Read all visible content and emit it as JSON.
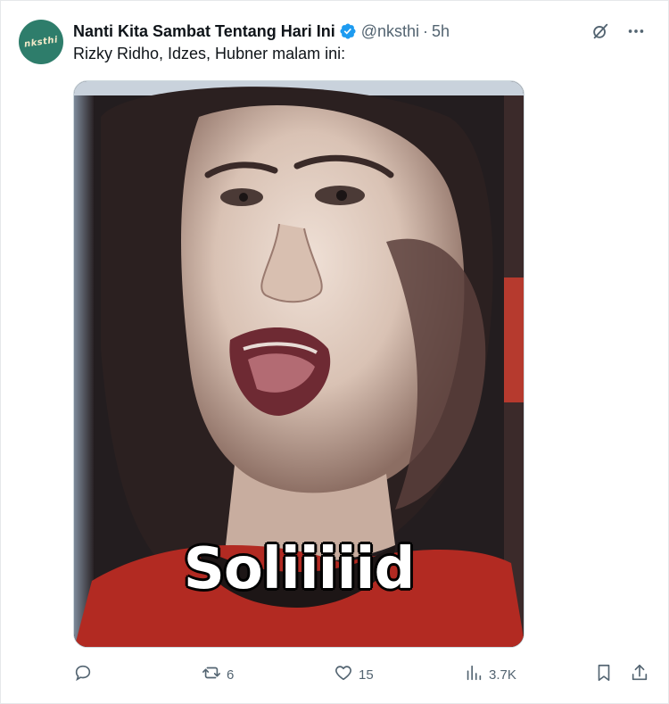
{
  "account": {
    "avatar_text": "nksthi",
    "display_name": "Nanti Kita Sambat Tentang Hari Ini",
    "handle": "@nksthi",
    "separator": "·",
    "time": "5h",
    "verified_color": "#1d9bf0"
  },
  "tweet": {
    "text": "Rizky Ridho, Idzes, Hubner malam ini:"
  },
  "media": {
    "caption": "Soliiiiid"
  },
  "actions": {
    "reply_count": "",
    "retweet_count": "6",
    "like_count": "15",
    "views_count": "3.7K"
  },
  "icons": [
    "grok-icon",
    "more-icon",
    "reply-icon",
    "retweet-icon",
    "like-icon",
    "views-icon",
    "bookmark-icon",
    "share-icon"
  ]
}
